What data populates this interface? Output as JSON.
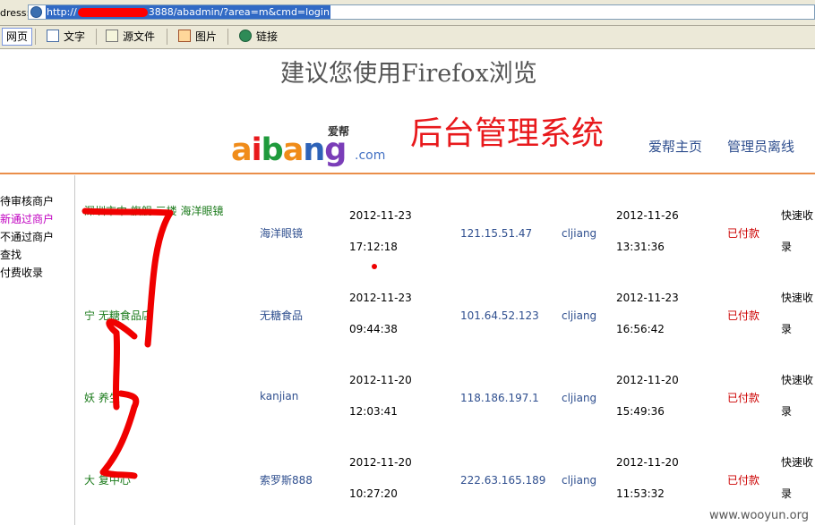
{
  "browser": {
    "address_label": "dress:",
    "url_prefix": "http://",
    "url_suffix": "3888/abadmin/?area=m&cmd=login",
    "toolbar": [
      {
        "label": "网页",
        "icon": "webpage-icon"
      },
      {
        "label": "文字",
        "icon": "text-icon"
      },
      {
        "label": "源文件",
        "icon": "source-file-icon"
      },
      {
        "label": "图片",
        "icon": "picture-icon"
      },
      {
        "label": "链接",
        "icon": "link-icon"
      }
    ]
  },
  "header": {
    "notice": "建议您使用Firefox浏览",
    "logo_cn": "爱帮",
    "logo_main": "aibang",
    "logo_com": ".com",
    "system_title": "后台管理系统",
    "home_link": "爱帮主页",
    "logout_link": "管理员离线"
  },
  "nav": {
    "items": [
      {
        "label": "待审核商户"
      },
      {
        "label": "新通过商户"
      },
      {
        "label": "不通过商户"
      },
      {
        "label": "查找"
      },
      {
        "label": "付费收录"
      }
    ],
    "selected": "新通过商户"
  },
  "table": {
    "rows": [
      {
        "name": "深圳市中 旗舰 三楼 海洋眼镜",
        "brand": "海洋眼镜",
        "created_date": "2012-11-23",
        "created_time": "17:12:18",
        "ip": "121.15.51.47",
        "user": "cljiang",
        "paid_date": "2012-11-26",
        "paid_time": "13:31:36",
        "status": "已付款",
        "action": "快速收录"
      },
      {
        "name": "宁 无糖食品店",
        "brand": "无糖食品",
        "created_date": "2012-11-23",
        "created_time": "09:44:38",
        "ip": "101.64.52.123",
        "user": "cljiang",
        "paid_date": "2012-11-23",
        "paid_time": "16:56:42",
        "status": "已付款",
        "action": "快速收录"
      },
      {
        "name": "妖 养生",
        "brand": "kanjian",
        "created_date": "2012-11-20",
        "created_time": "12:03:41",
        "ip": "118.186.197.1",
        "user": "cljiang",
        "paid_date": "2012-11-20",
        "paid_time": "15:49:36",
        "status": "已付款",
        "action": "快速收录"
      },
      {
        "name": "大 复中心",
        "brand": "索罗斯888",
        "created_date": "2012-11-20",
        "created_time": "10:27:20",
        "ip": "222.63.165.189",
        "user": "cljiang",
        "paid_date": "2012-11-20",
        "paid_time": "11:53:32",
        "status": "已付款",
        "action": "快速收录"
      }
    ]
  },
  "watermark": "www.wooyun.org",
  "colors": {
    "accent_red": "#e8191c",
    "link_blue": "#2f4f8f",
    "name_green": "#1a7a1a",
    "divider_orange": "#ea8e4a"
  }
}
